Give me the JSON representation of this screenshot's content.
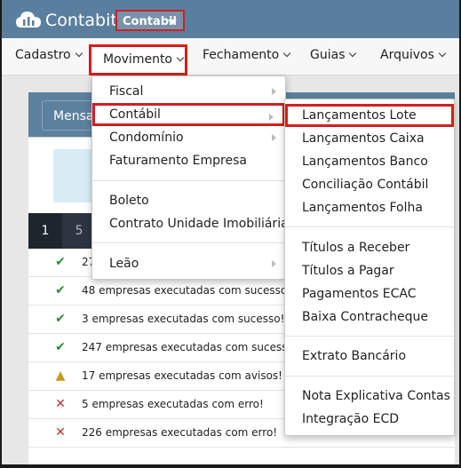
{
  "app": {
    "title": "Contabit",
    "company": "Contabil"
  },
  "menu": {
    "cadastro": "Cadastro",
    "movimento": "Movimento",
    "fechamento": "Fechamento",
    "guias": "Guias",
    "arquivos": "Arquivos"
  },
  "movimento_menu": {
    "fiscal": "Fiscal",
    "contabil": "Contábil",
    "condominio": "Condomínio",
    "faturamento": "Faturamento Empresa",
    "boleto": "Boleto",
    "contrato": "Contrato Unidade Imobiliária",
    "leao": "Leão"
  },
  "contabil_menu": {
    "lancamentos_lote": "Lançamentos Lote",
    "lancamentos_caixa": "Lançamentos Caixa",
    "lancamentos_banco": "Lançamentos Banco",
    "conciliacao": "Conciliação Contábil",
    "lancamentos_folha": "Lançamentos Folha",
    "titulos_receber": "Títulos a Receber",
    "titulos_pagar": "Títulos a Pagar",
    "pagamentos_ecac": "Pagamentos ECAC",
    "baixa_contracheque": "Baixa Contracheque",
    "extrato_bancario": "Extrato Bancário",
    "nota_explicativa": "Nota Explicativa Contas",
    "integracao_ecd": "Integração ECD"
  },
  "panel": {
    "button": "Mensa"
  },
  "pager": {
    "p1": "1",
    "p5": "5"
  },
  "rows": [
    {
      "icon": "check-icon",
      "text": "27"
    },
    {
      "icon": "check-icon",
      "text": "48 empresas executadas com sucesso!"
    },
    {
      "icon": "check-icon",
      "text": "3 empresas executadas com sucesso!"
    },
    {
      "icon": "check-icon",
      "text": "247 empresas executadas com sucesso!"
    },
    {
      "icon": "warning-icon",
      "text": "17 empresas executadas com avisos!"
    },
    {
      "icon": "error-icon",
      "text": "5 empresas executadas com erro!"
    },
    {
      "icon": "error-icon",
      "text": "226 empresas executadas com erro!"
    }
  ],
  "colors": {
    "topbar": "#5a7f9e",
    "highlight": "#d21f1f",
    "pager": "#2d3540"
  }
}
